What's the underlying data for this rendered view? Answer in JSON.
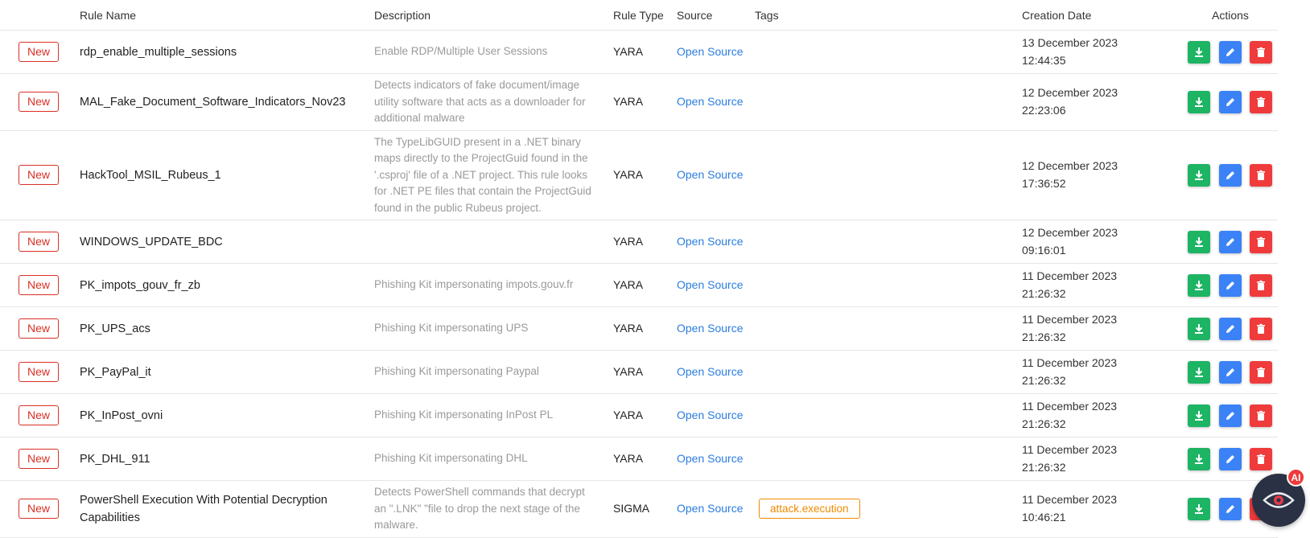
{
  "columns": {
    "rule_name": "Rule Name",
    "description": "Description",
    "rule_type": "Rule Type",
    "source": "Source",
    "tags": "Tags",
    "creation_date": "Creation Date",
    "actions": "Actions"
  },
  "rows": [
    {
      "badge": "New",
      "name": "rdp_enable_multiple_sessions",
      "description": "Enable RDP/Multiple User Sessions",
      "type": "YARA",
      "source": "Open Source",
      "tag": "",
      "date_line1": "13 December 2023",
      "date_line2": "12:44:35"
    },
    {
      "badge": "New",
      "name": "MAL_Fake_Document_Software_Indicators_Nov23",
      "description": "Detects indicators of fake document/image utility software that acts as a downloader for additional malware",
      "type": "YARA",
      "source": "Open Source",
      "tag": "",
      "date_line1": "12 December 2023",
      "date_line2": "22:23:06"
    },
    {
      "badge": "New",
      "name": "HackTool_MSIL_Rubeus_1",
      "description": "The TypeLibGUID present in a .NET binary maps directly to the ProjectGuid found in the '.csproj' file of a .NET project. This rule looks for .NET PE files that contain the ProjectGuid found in the public Rubeus project.",
      "type": "YARA",
      "source": "Open Source",
      "tag": "",
      "date_line1": "12 December 2023",
      "date_line2": "17:36:52"
    },
    {
      "badge": "New",
      "name": "WINDOWS_UPDATE_BDC",
      "description": "",
      "type": "YARA",
      "source": "Open Source",
      "tag": "",
      "date_line1": "12 December 2023",
      "date_line2": "09:16:01"
    },
    {
      "badge": "New",
      "name": "PK_impots_gouv_fr_zb",
      "description": "Phishing Kit impersonating impots.gouv.fr",
      "type": "YARA",
      "source": "Open Source",
      "tag": "",
      "date_line1": "11 December 2023",
      "date_line2": "21:26:32"
    },
    {
      "badge": "New",
      "name": "PK_UPS_acs",
      "description": "Phishing Kit impersonating UPS",
      "type": "YARA",
      "source": "Open Source",
      "tag": "",
      "date_line1": "11 December 2023",
      "date_line2": "21:26:32"
    },
    {
      "badge": "New",
      "name": "PK_PayPal_it",
      "description": "Phishing Kit impersonating Paypal",
      "type": "YARA",
      "source": "Open Source",
      "tag": "",
      "date_line1": "11 December 2023",
      "date_line2": "21:26:32"
    },
    {
      "badge": "New",
      "name": "PK_InPost_ovni",
      "description": "Phishing Kit impersonating InPost PL",
      "type": "YARA",
      "source": "Open Source",
      "tag": "",
      "date_line1": "11 December 2023",
      "date_line2": "21:26:32"
    },
    {
      "badge": "New",
      "name": "PK_DHL_911",
      "description": "Phishing Kit impersonating DHL",
      "type": "YARA",
      "source": "Open Source",
      "tag": "",
      "date_line1": "11 December 2023",
      "date_line2": "21:26:32"
    },
    {
      "badge": "New",
      "name": "PowerShell Execution With Potential Decryption Capabilities",
      "description": "Detects PowerShell commands that decrypt an \".LNK\" \"file to drop the next stage of the malware.",
      "type": "SIGMA",
      "source": "Open Source",
      "tag": "attack.execution",
      "date_line1": "11 December 2023",
      "date_line2": "10:46:21"
    }
  ],
  "actions": {
    "download_icon": "download-icon",
    "edit_icon": "pencil-icon",
    "delete_icon": "trash-icon"
  },
  "ai_widget": {
    "badge": "AI",
    "icon": "eye-icon"
  },
  "colors": {
    "badge_red": "#d93025",
    "link_blue": "#2b7de0",
    "download_green": "#1db464",
    "edit_blue": "#3b82f6",
    "delete_red": "#ef3b3b",
    "tag_orange": "#f08a00"
  }
}
